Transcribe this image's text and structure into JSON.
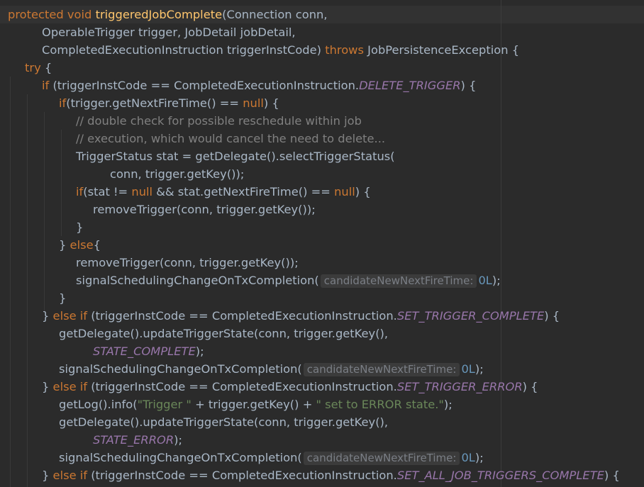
{
  "editor": {
    "theme_colors": {
      "background": "#2b2b2b",
      "keyword": "#cc7832",
      "method_decl": "#ffc66d",
      "comment": "#808080",
      "string": "#6a8759",
      "constant": "#9876aa",
      "number": "#6897bb",
      "text": "#a9b7c6"
    },
    "lines": [
      {
        "indent": 0,
        "tokens": [
          {
            "text": "protected",
            "kind": "kw"
          },
          {
            "text": " "
          },
          {
            "text": "void",
            "kind": "kw"
          },
          {
            "text": " "
          },
          {
            "text": "triggeredJobComplete",
            "kind": "fn"
          },
          {
            "text": "(Connection conn,"
          }
        ]
      },
      {
        "indent": 2,
        "tokens": [
          {
            "text": "OperableTrigger trigger, JobDetail jobDetail,"
          }
        ]
      },
      {
        "indent": 2,
        "tokens": [
          {
            "text": "CompletedExecutionInstruction triggerInstCode) "
          },
          {
            "text": "throws",
            "kind": "kw"
          },
          {
            "text": " JobPersistenceException {"
          }
        ]
      },
      {
        "indent": 1,
        "tokens": [
          {
            "text": "try",
            "kind": "kw"
          },
          {
            "text": " {"
          }
        ]
      },
      {
        "indent": 2,
        "tokens": [
          {
            "text": "if",
            "kind": "kw"
          },
          {
            "text": " (triggerInstCode == CompletedExecutionInstruction."
          },
          {
            "text": "DELETE_TRIGGER",
            "kind": "cn"
          },
          {
            "text": ") {"
          }
        ]
      },
      {
        "indent": 3,
        "tokens": [
          {
            "text": "if",
            "kind": "kw"
          },
          {
            "text": "(trigger.getNextFireTime() == "
          },
          {
            "text": "null",
            "kind": "kw"
          },
          {
            "text": ") {"
          }
        ]
      },
      {
        "indent": 4,
        "tokens": [
          {
            "text": "// double check for possible reschedule within job",
            "kind": "cm"
          }
        ]
      },
      {
        "indent": 4,
        "tokens": [
          {
            "text": "// execution, which would cancel the need to delete...",
            "kind": "cm"
          }
        ]
      },
      {
        "indent": 4,
        "tokens": [
          {
            "text": "TriggerStatus stat = getDelegate().selectTriggerStatus("
          }
        ]
      },
      {
        "indent": 6,
        "tokens": [
          {
            "text": "conn, trigger.getKey());"
          }
        ]
      },
      {
        "indent": 4,
        "tokens": [
          {
            "text": "if",
            "kind": "kw"
          },
          {
            "text": "(stat != "
          },
          {
            "text": "null",
            "kind": "kw"
          },
          {
            "text": " && stat.getNextFireTime() == "
          },
          {
            "text": "null",
            "kind": "kw"
          },
          {
            "text": ") {"
          }
        ]
      },
      {
        "indent": 5,
        "tokens": [
          {
            "text": "removeTrigger(conn, trigger.getKey());"
          }
        ]
      },
      {
        "indent": 4,
        "tokens": [
          {
            "text": "}"
          }
        ]
      },
      {
        "indent": 3,
        "tokens": [
          {
            "text": "} "
          },
          {
            "text": "else",
            "kind": "kw"
          },
          {
            "text": "{"
          }
        ]
      },
      {
        "indent": 4,
        "tokens": [
          {
            "text": "removeTrigger(conn, trigger.getKey());"
          }
        ]
      },
      {
        "indent": 4,
        "tokens": [
          {
            "text": "signalSchedulingChangeOnTxCompletion("
          },
          {
            "text": "candidateNewNextFireTime:",
            "kind": "hint"
          },
          {
            "text": "0L",
            "kind": "nm"
          },
          {
            "text": ");"
          }
        ]
      },
      {
        "indent": 3,
        "tokens": [
          {
            "text": "}"
          }
        ]
      },
      {
        "indent": 2,
        "tokens": [
          {
            "text": "} "
          },
          {
            "text": "else if",
            "kind": "kw"
          },
          {
            "text": " (triggerInstCode == CompletedExecutionInstruction."
          },
          {
            "text": "SET_TRIGGER_COMPLETE",
            "kind": "cn"
          },
          {
            "text": ") {"
          }
        ]
      },
      {
        "indent": 3,
        "tokens": [
          {
            "text": "getDelegate().updateTriggerState(conn, trigger.getKey(),"
          }
        ]
      },
      {
        "indent": 5,
        "tokens": [
          {
            "text": "STATE_COMPLETE",
            "kind": "cn"
          },
          {
            "text": ");"
          }
        ]
      },
      {
        "indent": 3,
        "tokens": [
          {
            "text": "signalSchedulingChangeOnTxCompletion("
          },
          {
            "text": "candidateNewNextFireTime:",
            "kind": "hint"
          },
          {
            "text": "0L",
            "kind": "nm"
          },
          {
            "text": ");"
          }
        ]
      },
      {
        "indent": 2,
        "tokens": [
          {
            "text": "} "
          },
          {
            "text": "else if",
            "kind": "kw"
          },
          {
            "text": " (triggerInstCode == CompletedExecutionInstruction."
          },
          {
            "text": "SET_TRIGGER_ERROR",
            "kind": "cn"
          },
          {
            "text": ") {"
          }
        ]
      },
      {
        "indent": 3,
        "tokens": [
          {
            "text": "getLog().info("
          },
          {
            "text": "\"Trigger \"",
            "kind": "st"
          },
          {
            "text": " + trigger.getKey() + "
          },
          {
            "text": "\" set to ERROR state.\"",
            "kind": "st"
          },
          {
            "text": ");"
          }
        ]
      },
      {
        "indent": 3,
        "tokens": [
          {
            "text": "getDelegate().updateTriggerState(conn, trigger.getKey(),"
          }
        ]
      },
      {
        "indent": 5,
        "tokens": [
          {
            "text": "STATE_ERROR",
            "kind": "cn"
          },
          {
            "text": ");"
          }
        ]
      },
      {
        "indent": 3,
        "tokens": [
          {
            "text": "signalSchedulingChangeOnTxCompletion("
          },
          {
            "text": "candidateNewNextFireTime:",
            "kind": "hint"
          },
          {
            "text": "0L",
            "kind": "nm"
          },
          {
            "text": ");"
          }
        ]
      },
      {
        "indent": 2,
        "tokens": [
          {
            "text": "} "
          },
          {
            "text": "else if",
            "kind": "kw"
          },
          {
            "text": " (triggerInstCode == CompletedExecutionInstruction."
          },
          {
            "text": "SET_ALL_JOB_TRIGGERS_COMPLETE",
            "kind": "cn"
          },
          {
            "text": ") {"
          }
        ]
      }
    ]
  }
}
